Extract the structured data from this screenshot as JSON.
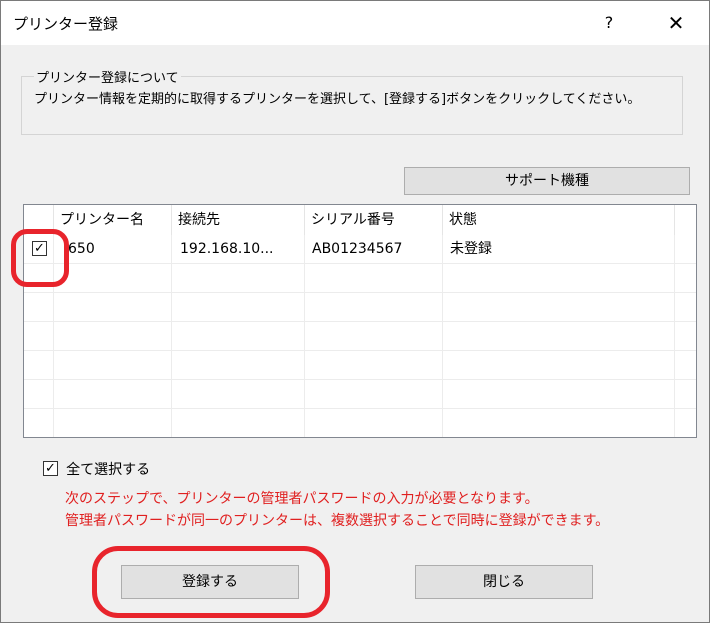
{
  "window": {
    "title": "プリンター登録",
    "help_label": "?",
    "close_label": "✕"
  },
  "group": {
    "legend": "プリンター登録について",
    "description": "プリンター情報を定期的に取得するプリンターを選択して、[登録する]ボタンをクリックしてください。"
  },
  "support_button_label": "サポート機種",
  "table": {
    "columns": [
      "",
      "プリンター名",
      "接続先",
      "シリアル番号",
      "状態"
    ],
    "rows": [
      {
        "checked": true,
        "printer_name": "650",
        "connection": "192.168.10...",
        "serial": "AB01234567",
        "status": "未登録"
      }
    ]
  },
  "select_all": {
    "label": "全て選択する",
    "checked": true
  },
  "notice": {
    "line1": "次のステップで、プリンターの管理者パスワードの入力が必要となります。",
    "line2": "管理者パスワードが同一のプリンターは、複数選択することで同時に登録ができます。"
  },
  "buttons": {
    "register_label": "登録する",
    "close_label": "閉じる"
  },
  "checkmark": "✓",
  "colors": {
    "callout": "#e8242c",
    "notice_text": "#e02020",
    "button_face": "#e1e1e1",
    "dialog_bg": "#f0f0f0"
  }
}
